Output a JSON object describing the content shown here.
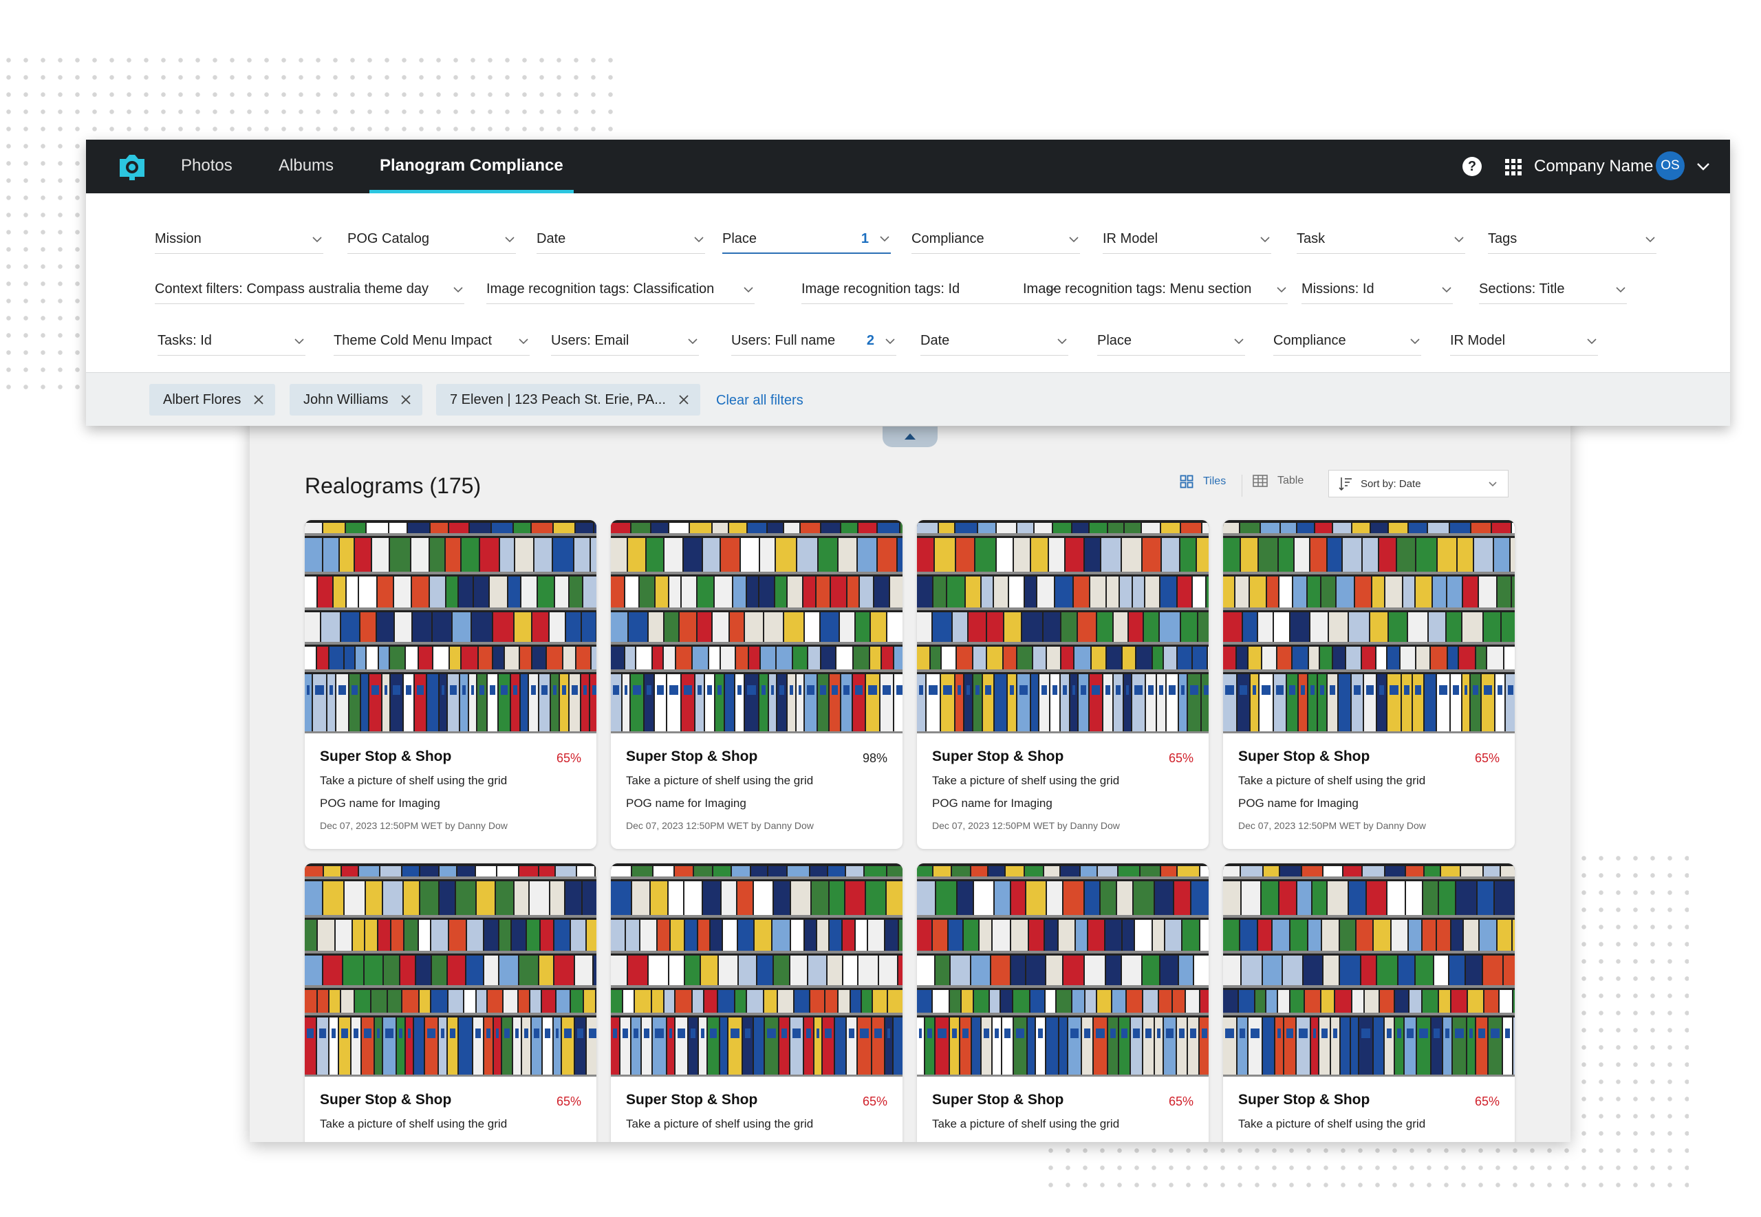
{
  "nav": {
    "items": [
      {
        "label": "Photos"
      },
      {
        "label": "Albums"
      },
      {
        "label": "Planogram Compliance"
      }
    ],
    "help": "?",
    "company": "Company Name",
    "avatar": "OS"
  },
  "filters": {
    "row1": [
      {
        "label": "Mission",
        "count": ""
      },
      {
        "label": "POG Catalog",
        "count": ""
      },
      {
        "label": "Date",
        "count": ""
      },
      {
        "label": "Place",
        "count": "1"
      },
      {
        "label": "Compliance",
        "count": ""
      },
      {
        "label": "IR Model",
        "count": ""
      },
      {
        "label": "Task",
        "count": ""
      },
      {
        "label": "Tags",
        "count": ""
      }
    ],
    "row2": [
      {
        "label": "Context filters: Compass australia theme day"
      },
      {
        "label": "Image recognition tags: Classification"
      },
      {
        "label": "Image recognition tags: Id"
      },
      {
        "label": "Image recognition tags: Menu section"
      },
      {
        "label": "Missions: Id"
      },
      {
        "label": "Sections: Title"
      }
    ],
    "row3": [
      {
        "label": "Tasks: Id",
        "count": ""
      },
      {
        "label": "Theme Cold Menu Impact",
        "count": ""
      },
      {
        "label": "Users: Email",
        "count": ""
      },
      {
        "label": "Users: Full name",
        "count": "2"
      },
      {
        "label": "Date",
        "count": ""
      },
      {
        "label": "Place",
        "count": ""
      },
      {
        "label": "Compliance",
        "count": ""
      },
      {
        "label": "IR Model",
        "count": ""
      }
    ]
  },
  "chips": [
    {
      "label": "Albert Flores"
    },
    {
      "label": "John Williams"
    },
    {
      "label": "7 Eleven | 123 Peach St. Erie, PA..."
    }
  ],
  "clear_all": "Clear all filters",
  "results": {
    "title": "Realograms (175)",
    "view_tiles": "Tiles",
    "view_table": "Table",
    "sort": "Sort by: Date"
  },
  "cards": [
    {
      "title": "Super Stop & Shop",
      "score": "65%",
      "task": "Take a picture of shelf using the grid",
      "pog": "POG name for Imaging",
      "meta": "Dec 07, 2023 12:50PM WET by Danny Dow"
    },
    {
      "title": "Super Stop & Shop",
      "score": "98%",
      "task": "Take a picture of shelf using the grid",
      "pog": "POG name for Imaging",
      "meta": "Dec 07, 2023 12:50PM WET by Danny Dow"
    },
    {
      "title": "Super Stop & Shop",
      "score": "65%",
      "task": "Take a picture of shelf using the grid",
      "pog": "POG name for Imaging",
      "meta": "Dec 07, 2023 12:50PM WET by Danny Dow"
    },
    {
      "title": "Super Stop & Shop",
      "score": "65%",
      "task": "Take a picture of shelf using the grid",
      "pog": "POG name for Imaging",
      "meta": "Dec 07, 2023 12:50PM WET by Danny Dow"
    },
    {
      "title": "Super Stop & Shop",
      "score": "65%",
      "task": "Take a picture of shelf using the grid",
      "pog": "",
      "meta": ""
    },
    {
      "title": "Super Stop & Shop",
      "score": "65%",
      "task": "Take a picture of shelf using the grid",
      "pog": "",
      "meta": ""
    },
    {
      "title": "Super Stop & Shop",
      "score": "65%",
      "task": "Take a picture of shelf using the grid",
      "pog": "",
      "meta": ""
    },
    {
      "title": "Super Stop & Shop",
      "score": "65%",
      "task": "Take a picture of shelf using the grid",
      "pog": "",
      "meta": ""
    }
  ],
  "colors": {
    "navbar": "#1e2124",
    "accent": "#2cc6e0",
    "link": "#1c6fc0",
    "score_low": "#d0202a",
    "chip_bg": "#dbe5ec"
  }
}
